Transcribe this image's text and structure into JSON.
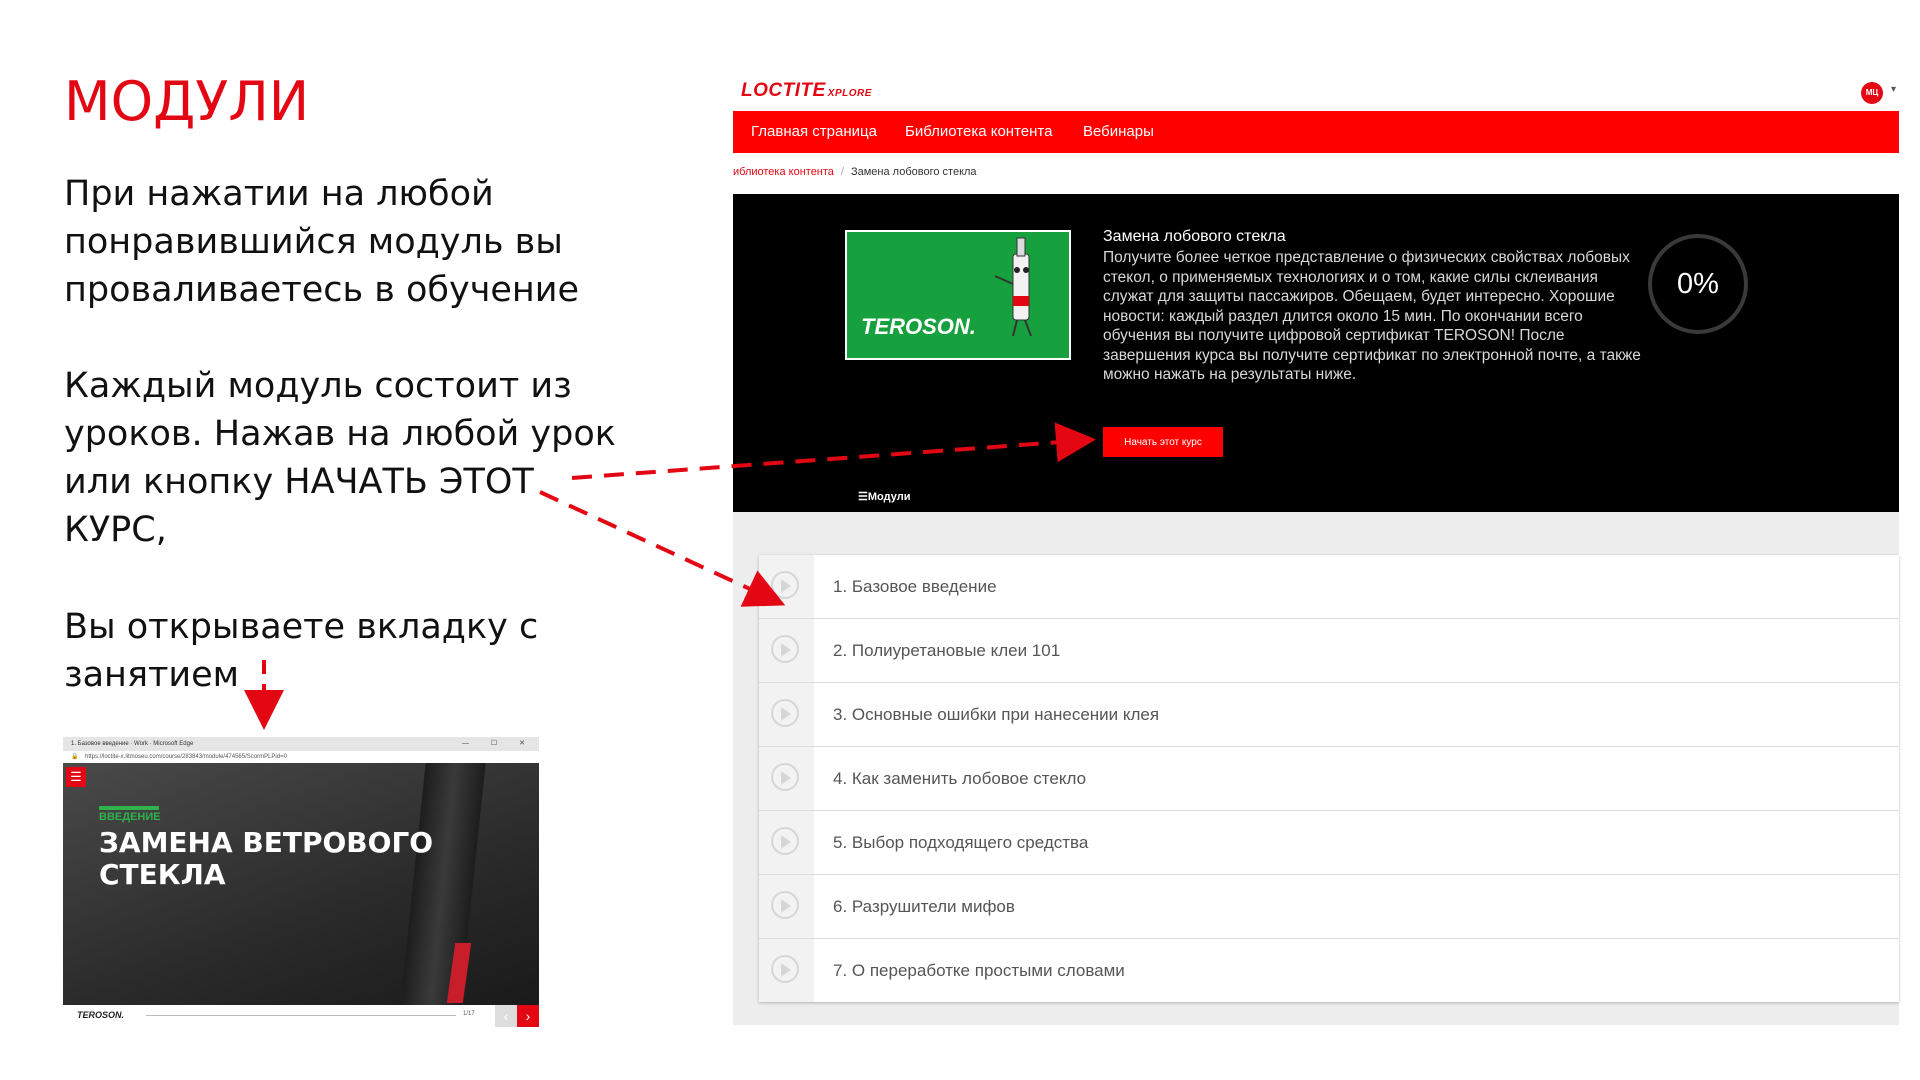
{
  "slide": {
    "title": "МОДУЛИ",
    "p1": [
      "При нажатии на любой",
      "понравившийся модуль вы",
      "проваливаетесь в обучение"
    ],
    "p2": [
      "Каждый модуль состоит из",
      "уроков. Нажав на любой урок",
      "или кнопку НАЧАТЬ ЭТОТ",
      "КУРС,"
    ],
    "p3": [
      "Вы открываете вкладку с",
      "занятием"
    ]
  },
  "app": {
    "logo": "LOCTITE",
    "logo_suffix": "XPLORE",
    "avatar": "МЦ",
    "nav": [
      "Главная страница",
      "Библиотека контента",
      "Вебинары"
    ],
    "breadcrumb": {
      "parent": "иблиотека контента",
      "sep": "/",
      "current": "Замена лобового стекла"
    },
    "course": {
      "brand": "TEROSON.",
      "title": "Замена лобового стекла",
      "description": "Получите более четкое представление о физических свойствах лобовых стекол, о применяемых технологиях и о том, какие силы склеивания служат для защиты пассажиров. Обещаем, будет интересно. Хорошие новости: каждый раздел длится около 15 мин. По окончании всего обучения вы получите цифровой сертификат TEROSON! После завершения курса вы получите сертификат по электронной почте, а также можно нажать на результаты ниже.",
      "progress": "0%",
      "progress_value": 0,
      "start_label": "Начать этот курс",
      "modules_tab": "Модули"
    },
    "lessons": [
      "1. Базовое введение",
      "2. Полиуретановые клеи 101",
      "3. Основные ошибки при нанесении клея",
      "4. Как заменить лобовое стекло",
      "5. Выбор подходящего средства",
      "6. Разрушители мифов",
      "7. О переработке простыми словами"
    ]
  },
  "mini": {
    "window_title": "1. Базовое введение · Work · Microsoft Edge",
    "url": "https://loctite-x.litmoseu.com/course/283843/module/474565/ScormPLPid=0",
    "intro": "ВВЕДЕНИЕ",
    "headline": "ЗАМЕНА ВЕТРОВОГО СТЕКЛА",
    "footer_logo": "TEROSON.",
    "page": "1/17"
  },
  "colors": {
    "accent": "#e30613",
    "nav": "#ff0000",
    "hero": "#000000"
  }
}
